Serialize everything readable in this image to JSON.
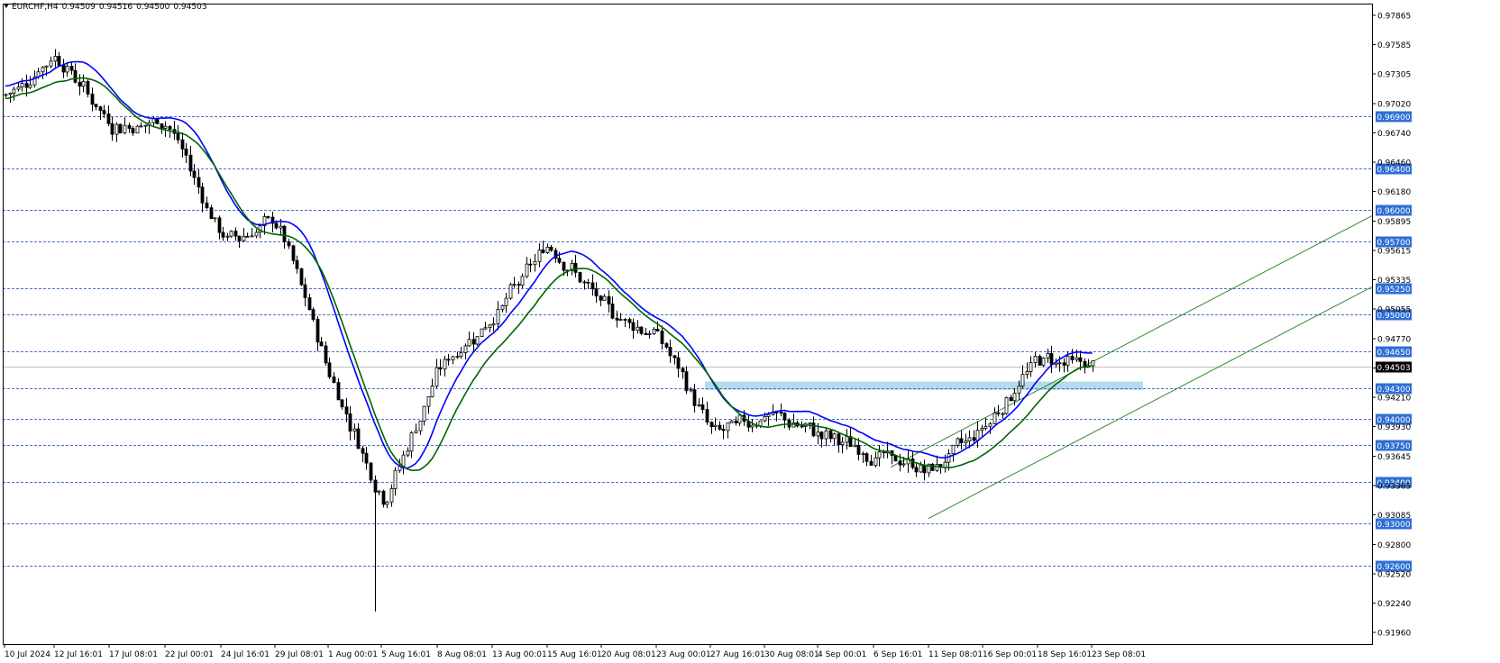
{
  "header": {
    "symbol": "EURCHF,H4",
    "open": "0.94509",
    "high": "0.94516",
    "low": "0.94500",
    "close": "0.94503"
  },
  "colors": {
    "background": "#ffffff",
    "candle": "#000000",
    "ma_fast": "#0000ff",
    "ma_slow": "#006400",
    "level_line": "#4a72c4",
    "level_tag_bg": "#2f6fd6",
    "price_tag_bg": "#000000",
    "channel": "#2e8b2e",
    "zone": "#a7d3ea"
  },
  "chart_data": {
    "type": "candlestick",
    "symbol": "EURCHF",
    "timeframe": "H4",
    "y_ticks": [
      "0.97865",
      "0.97585",
      "0.97305",
      "0.97020",
      "0.96740",
      "0.96460",
      "0.96180",
      "0.95895",
      "0.95615",
      "0.95335",
      "0.95055",
      "0.94770",
      "0.94490",
      "0.94210",
      "0.93930",
      "0.93645",
      "0.93365",
      "0.93085",
      "0.92800",
      "0.92520",
      "0.92240",
      "0.91960"
    ],
    "x_ticks": [
      "10 Jul 2024",
      "12 Jul 16:01",
      "17 Jul 08:01",
      "22 Jul 00:01",
      "24 Jul 16:01",
      "29 Jul 08:01",
      "1 Aug 00:01",
      "5 Aug 16:01",
      "8 Aug 08:01",
      "13 Aug 00:01",
      "15 Aug 16:01",
      "20 Aug 08:01",
      "23 Aug 00:01",
      "27 Aug 16:01",
      "30 Aug 08:01",
      "4 Sep 00:01",
      "6 Sep 16:01",
      "11 Sep 08:01",
      "16 Sep 00:01",
      "18 Sep 16:01",
      "23 Sep 08:01"
    ],
    "horizontal_levels": [
      "0.96900",
      "0.96400",
      "0.96000",
      "0.95700",
      "0.95250",
      "0.95000",
      "0.94650",
      "0.94300",
      "0.94000",
      "0.93750",
      "0.93400",
      "0.93000",
      "0.92600"
    ],
    "current_price": "0.94503",
    "zone": {
      "from": 0.9428,
      "to": 0.9436
    },
    "channel": {
      "start": [
        "11 Sep 08:01",
        0.9305
      ],
      "upper_start_price": 0.9373,
      "slope_per_h4_bar": 0.000205
    },
    "anchors": [
      {
        "x": "10 Jul 2024",
        "y": 0.971
      },
      {
        "x": "12 Jul 16:01",
        "y": 0.975
      },
      {
        "x": "17 Jul 08:01",
        "y": 0.968
      },
      {
        "x": "22 Jul 00:01",
        "y": 0.9685
      },
      {
        "x": "24 Jul 16:01",
        "y": 0.957
      },
      {
        "x": "29 Jul 08:01",
        "y": 0.959
      },
      {
        "x": "1 Aug 00:01",
        "y": 0.944
      },
      {
        "x": "5 Aug 16:01",
        "y": 0.932
      },
      {
        "x": "8 Aug 08:01",
        "y": 0.945
      },
      {
        "x": "13 Aug 00:01",
        "y": 0.95
      },
      {
        "x": "15 Aug 16:01",
        "y": 0.957
      },
      {
        "x": "20 Aug 08:01",
        "y": 0.9505
      },
      {
        "x": "23 Aug 00:01",
        "y": 0.948
      },
      {
        "x": "27 Aug 16:01",
        "y": 0.9385
      },
      {
        "x": "30 Aug 08:01",
        "y": 0.9405
      },
      {
        "x": "4 Sep 00:01",
        "y": 0.9385
      },
      {
        "x": "6 Sep 16:01",
        "y": 0.9365
      },
      {
        "x": "11 Sep 08:01",
        "y": 0.935
      },
      {
        "x": "16 Sep 00:01",
        "y": 0.9395
      },
      {
        "x": "18 Sep 16:01",
        "y": 0.946
      },
      {
        "x": "23 Sep 08:01",
        "y": 0.945
      }
    ],
    "series": [
      {
        "name": "",
        "color": "#0000ff"
      },
      {
        "name": "",
        "color": "#006400"
      }
    ]
  }
}
